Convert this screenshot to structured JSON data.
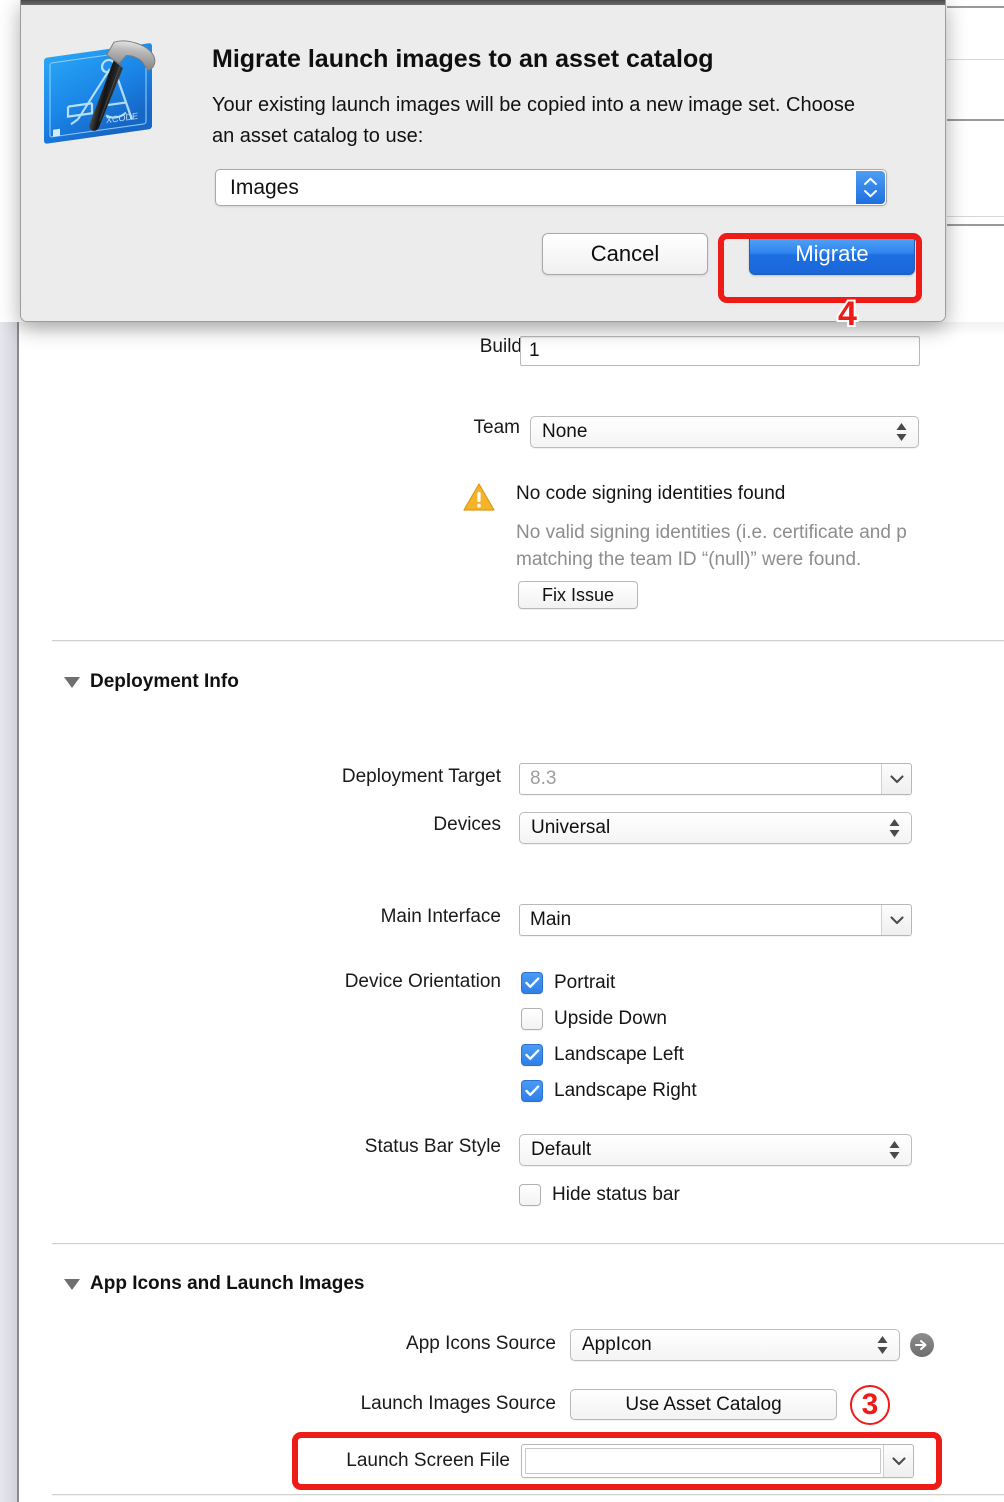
{
  "app": {
    "name": "Xcode",
    "icon": "xcode-app-icon"
  },
  "sheet": {
    "title": "Migrate launch images to an asset catalog",
    "body_line1": "Your existing launch images will be copied into a new image",
    "body_line2": "set. Choose an asset catalog to use:",
    "catalog_popup": {
      "value": "Images",
      "icon": "stepper-up-down-icon"
    },
    "cancel_label": "Cancel",
    "migrate_label": "Migrate"
  },
  "annotations": [
    {
      "number": "4",
      "style": "plain",
      "target": "migrate-button"
    },
    {
      "number": "3",
      "style": "circled",
      "target": "launch-images-source"
    }
  ],
  "inspector": {
    "identity": {
      "build": {
        "label": "Build",
        "value": "1"
      },
      "team": {
        "label": "Team",
        "value": "None",
        "icon": "double-chevron-icon"
      },
      "warning": {
        "icon": "warning-triangle-icon",
        "title": "No code signing identities found",
        "detail_line1": "No valid signing identities (i.e. certificate and p",
        "detail_line2": "matching the team ID “(null)” were found.",
        "fix_label": "Fix Issue"
      }
    },
    "deployment_info": {
      "section_title": "Deployment Info",
      "disclosure_icon": "triangle-down-icon",
      "deployment_target": {
        "label": "Deployment Target",
        "value": "8.3",
        "icon": "chevron-down-icon"
      },
      "devices": {
        "label": "Devices",
        "value": "Universal",
        "icon": "double-chevron-icon"
      },
      "main_interface": {
        "label": "Main Interface",
        "value": "Main",
        "icon": "chevron-down-icon"
      },
      "device_orientation": {
        "label": "Device Orientation",
        "options": [
          {
            "label": "Portrait",
            "checked": true
          },
          {
            "label": "Upside Down",
            "checked": false
          },
          {
            "label": "Landscape Left",
            "checked": true
          },
          {
            "label": "Landscape Right",
            "checked": true
          }
        ]
      },
      "status_bar_style": {
        "label": "Status Bar Style",
        "value": "Default",
        "icon": "double-chevron-icon"
      },
      "hide_status_bar": {
        "label": "Hide status bar",
        "checked": false
      }
    },
    "app_icons_section": {
      "section_title": "App Icons and Launch Images",
      "disclosure_icon": "triangle-down-icon",
      "app_icons_source": {
        "label": "App Icons Source",
        "value": "AppIcon",
        "icon": "double-chevron-icon",
        "reveal_icon": "circle-arrow-right-icon"
      },
      "launch_images_source": {
        "label": "Launch Images Source",
        "button_label": "Use Asset Catalog"
      },
      "launch_screen_file": {
        "label": "Launch Screen File",
        "value": "",
        "icon": "chevron-down-icon"
      }
    }
  },
  "colors": {
    "accent_blue": "#2f84ee",
    "annotation_red": "#ee1b17",
    "warning_amber": "#f3b020",
    "sheet_bg": "#ececec"
  }
}
